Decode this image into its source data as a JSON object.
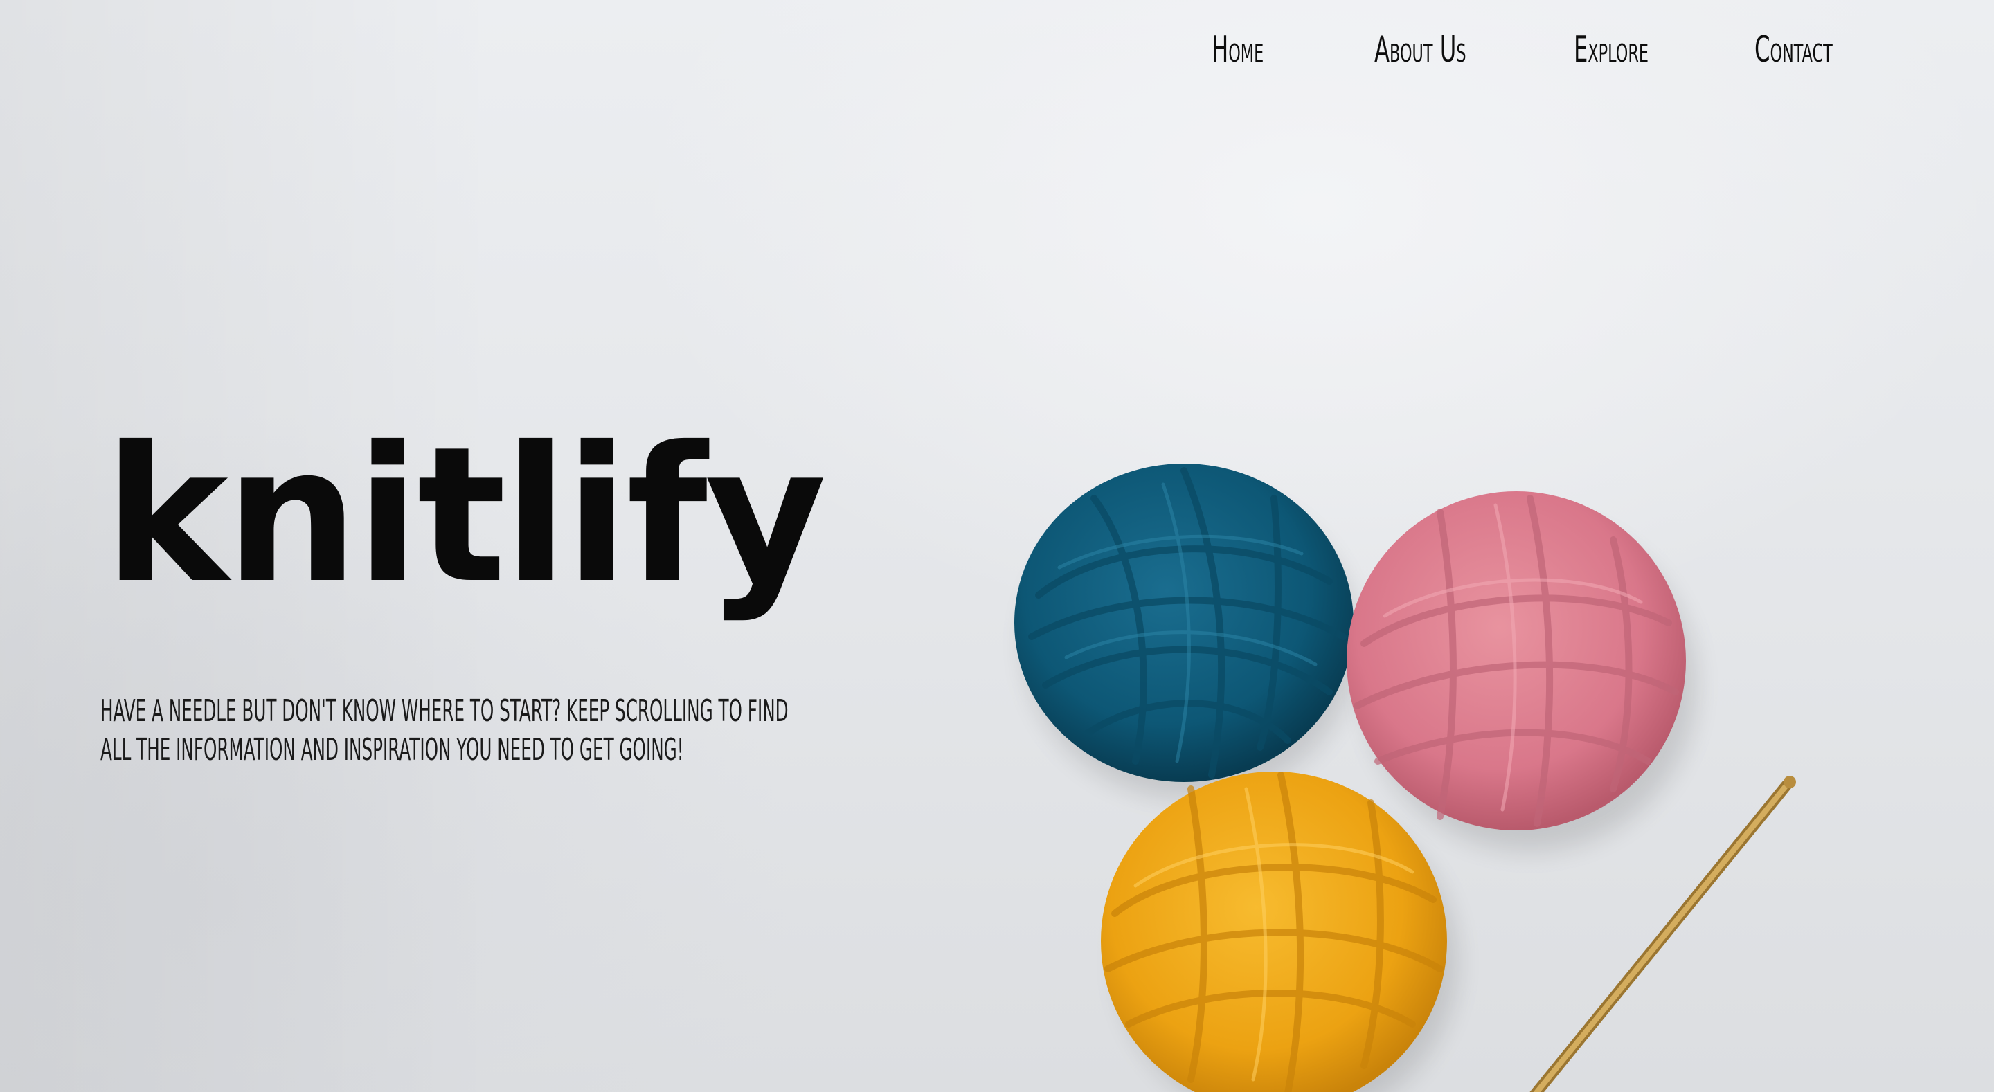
{
  "nav": {
    "items": [
      {
        "label": "Home"
      },
      {
        "label": "About Us"
      },
      {
        "label": "Explore"
      },
      {
        "label": "Contact"
      }
    ]
  },
  "hero": {
    "title": "knitlify",
    "tagline": "Have a needle but don't know where to start? Keep scrolling to find all the information and inspiration you need to get going!"
  },
  "colors": {
    "background": "#e8e9ec",
    "text": "#0d0d0d",
    "yarn_blue": "#0d5775",
    "yarn_pink": "#d9778a",
    "yarn_yellow": "#eca212",
    "hook": "#c8a050"
  },
  "image": {
    "subject": "yarn-balls-and-crochet-hook"
  }
}
